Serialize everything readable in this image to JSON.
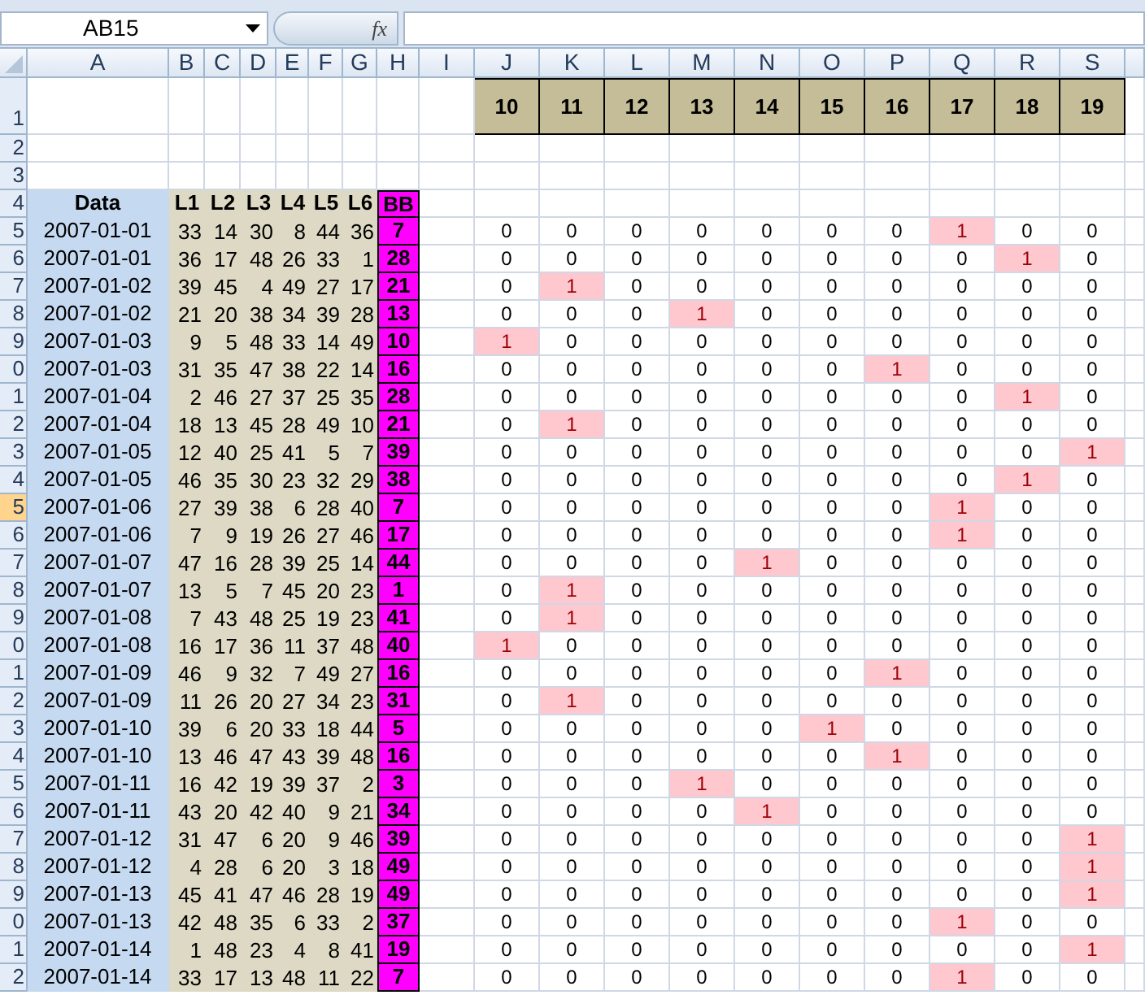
{
  "name_box": {
    "value": "AB15"
  },
  "function_button": "fx",
  "column_headers": [
    "A",
    "B",
    "C",
    "D",
    "E",
    "F",
    "G",
    "H",
    "I",
    "J",
    "K",
    "L",
    "M",
    "N",
    "O",
    "P",
    "Q",
    "R",
    "S"
  ],
  "row_headers": [
    {
      "text": "1",
      "selected": false
    },
    {
      "text": "2",
      "selected": false
    },
    {
      "text": "3",
      "selected": false
    },
    {
      "text": "4",
      "selected": false
    },
    {
      "text": "5",
      "selected": false
    },
    {
      "text": "6",
      "selected": false
    },
    {
      "text": "7",
      "selected": false
    },
    {
      "text": "8",
      "selected": false
    },
    {
      "text": "9",
      "selected": false
    },
    {
      "text": "0",
      "selected": false
    },
    {
      "text": "1",
      "selected": false
    },
    {
      "text": "2",
      "selected": false
    },
    {
      "text": "3",
      "selected": false
    },
    {
      "text": "4",
      "selected": false
    },
    {
      "text": "5",
      "selected": true
    },
    {
      "text": "6",
      "selected": false
    },
    {
      "text": "7",
      "selected": false
    },
    {
      "text": "8",
      "selected": false
    },
    {
      "text": "9",
      "selected": false
    },
    {
      "text": "0",
      "selected": false
    },
    {
      "text": "1",
      "selected": false
    },
    {
      "text": "2",
      "selected": false
    },
    {
      "text": "3",
      "selected": false
    },
    {
      "text": "4",
      "selected": false
    },
    {
      "text": "5",
      "selected": false
    },
    {
      "text": "6",
      "selected": false
    },
    {
      "text": "7",
      "selected": false
    },
    {
      "text": "8",
      "selected": false
    },
    {
      "text": "9",
      "selected": false
    },
    {
      "text": "0",
      "selected": false
    },
    {
      "text": "1",
      "selected": false
    },
    {
      "text": "2",
      "selected": false
    }
  ],
  "bin_headers": [
    "10",
    "11",
    "12",
    "13",
    "14",
    "15",
    "16",
    "17",
    "18",
    "19"
  ],
  "table_header": {
    "date": "Data",
    "numbers": [
      "L1",
      "L2",
      "L3",
      "L4",
      "L5",
      "L6"
    ],
    "bb": "BB"
  },
  "rows": [
    {
      "date": "2007-01-01",
      "numbers": [
        "33",
        "14",
        "30",
        "8",
        "44",
        "36"
      ],
      "bb": "7",
      "flags": [
        "0",
        "0",
        "0",
        "0",
        "0",
        "0",
        "0",
        "1",
        "0",
        "0"
      ],
      "highlighted": [
        false,
        false,
        false,
        false,
        false,
        false,
        false,
        true,
        false,
        false
      ]
    },
    {
      "date": "2007-01-01",
      "numbers": [
        "36",
        "17",
        "48",
        "26",
        "33",
        "1"
      ],
      "bb": "28",
      "flags": [
        "0",
        "0",
        "0",
        "0",
        "0",
        "0",
        "0",
        "0",
        "1",
        "0"
      ],
      "highlighted": [
        false,
        false,
        false,
        false,
        false,
        false,
        false,
        false,
        true,
        false
      ]
    },
    {
      "date": "2007-01-02",
      "numbers": [
        "39",
        "45",
        "4",
        "49",
        "27",
        "17"
      ],
      "bb": "21",
      "flags": [
        "0",
        "1",
        "0",
        "0",
        "0",
        "0",
        "0",
        "0",
        "0",
        "0"
      ],
      "highlighted": [
        false,
        true,
        false,
        false,
        false,
        false,
        false,
        false,
        false,
        false
      ]
    },
    {
      "date": "2007-01-02",
      "numbers": [
        "21",
        "20",
        "38",
        "34",
        "39",
        "28"
      ],
      "bb": "13",
      "flags": [
        "0",
        "0",
        "0",
        "1",
        "0",
        "0",
        "0",
        "0",
        "0",
        "0"
      ],
      "highlighted": [
        false,
        false,
        false,
        true,
        false,
        false,
        false,
        false,
        false,
        false
      ]
    },
    {
      "date": "2007-01-03",
      "numbers": [
        "9",
        "5",
        "48",
        "33",
        "14",
        "49"
      ],
      "bb": "10",
      "flags": [
        "1",
        "0",
        "0",
        "0",
        "0",
        "0",
        "0",
        "0",
        "0",
        "0"
      ],
      "highlighted": [
        true,
        false,
        false,
        false,
        false,
        false,
        false,
        false,
        false,
        false
      ]
    },
    {
      "date": "2007-01-03",
      "numbers": [
        "31",
        "35",
        "47",
        "38",
        "22",
        "14"
      ],
      "bb": "16",
      "flags": [
        "0",
        "0",
        "0",
        "0",
        "0",
        "0",
        "1",
        "0",
        "0",
        "0"
      ],
      "highlighted": [
        false,
        false,
        false,
        false,
        false,
        false,
        true,
        false,
        false,
        false
      ]
    },
    {
      "date": "2007-01-04",
      "numbers": [
        "2",
        "46",
        "27",
        "37",
        "25",
        "35"
      ],
      "bb": "28",
      "flags": [
        "0",
        "0",
        "0",
        "0",
        "0",
        "0",
        "0",
        "0",
        "1",
        "0"
      ],
      "highlighted": [
        false,
        false,
        false,
        false,
        false,
        false,
        false,
        false,
        true,
        false
      ]
    },
    {
      "date": "2007-01-04",
      "numbers": [
        "18",
        "13",
        "45",
        "28",
        "49",
        "10"
      ],
      "bb": "21",
      "flags": [
        "0",
        "1",
        "0",
        "0",
        "0",
        "0",
        "0",
        "0",
        "0",
        "0"
      ],
      "highlighted": [
        false,
        true,
        false,
        false,
        false,
        false,
        false,
        false,
        false,
        false
      ]
    },
    {
      "date": "2007-01-05",
      "numbers": [
        "12",
        "40",
        "25",
        "41",
        "5",
        "7"
      ],
      "bb": "39",
      "flags": [
        "0",
        "0",
        "0",
        "0",
        "0",
        "0",
        "0",
        "0",
        "0",
        "1"
      ],
      "highlighted": [
        false,
        false,
        false,
        false,
        false,
        false,
        false,
        false,
        false,
        true
      ]
    },
    {
      "date": "2007-01-05",
      "numbers": [
        "46",
        "35",
        "30",
        "23",
        "32",
        "29"
      ],
      "bb": "38",
      "flags": [
        "0",
        "0",
        "0",
        "0",
        "0",
        "0",
        "0",
        "0",
        "1",
        "0"
      ],
      "highlighted": [
        false,
        false,
        false,
        false,
        false,
        false,
        false,
        false,
        true,
        false
      ]
    },
    {
      "date": "2007-01-06",
      "numbers": [
        "27",
        "39",
        "38",
        "6",
        "28",
        "40"
      ],
      "bb": "7",
      "flags": [
        "0",
        "0",
        "0",
        "0",
        "0",
        "0",
        "0",
        "1",
        "0",
        "0"
      ],
      "highlighted": [
        false,
        false,
        false,
        false,
        false,
        false,
        false,
        true,
        false,
        false
      ]
    },
    {
      "date": "2007-01-06",
      "numbers": [
        "7",
        "9",
        "19",
        "26",
        "27",
        "46"
      ],
      "bb": "17",
      "flags": [
        "0",
        "0",
        "0",
        "0",
        "0",
        "0",
        "0",
        "1",
        "0",
        "0"
      ],
      "highlighted": [
        false,
        false,
        false,
        false,
        false,
        false,
        false,
        true,
        false,
        false
      ]
    },
    {
      "date": "2007-01-07",
      "numbers": [
        "47",
        "16",
        "28",
        "39",
        "25",
        "14"
      ],
      "bb": "44",
      "flags": [
        "0",
        "0",
        "0",
        "0",
        "1",
        "0",
        "0",
        "0",
        "0",
        "0"
      ],
      "highlighted": [
        false,
        false,
        false,
        false,
        true,
        false,
        false,
        false,
        false,
        false
      ]
    },
    {
      "date": "2007-01-07",
      "numbers": [
        "13",
        "5",
        "7",
        "45",
        "20",
        "23"
      ],
      "bb": "1",
      "flags": [
        "0",
        "1",
        "0",
        "0",
        "0",
        "0",
        "0",
        "0",
        "0",
        "0"
      ],
      "highlighted": [
        false,
        true,
        false,
        false,
        false,
        false,
        false,
        false,
        false,
        false
      ]
    },
    {
      "date": "2007-01-08",
      "numbers": [
        "7",
        "43",
        "48",
        "25",
        "19",
        "23"
      ],
      "bb": "41",
      "flags": [
        "0",
        "1",
        "0",
        "0",
        "0",
        "0",
        "0",
        "0",
        "0",
        "0"
      ],
      "highlighted": [
        false,
        true,
        false,
        false,
        false,
        false,
        false,
        false,
        false,
        false
      ]
    },
    {
      "date": "2007-01-08",
      "numbers": [
        "16",
        "17",
        "36",
        "11",
        "37",
        "48"
      ],
      "bb": "40",
      "flags": [
        "1",
        "0",
        "0",
        "0",
        "0",
        "0",
        "0",
        "0",
        "0",
        "0"
      ],
      "highlighted": [
        true,
        false,
        false,
        false,
        false,
        false,
        false,
        false,
        false,
        false
      ]
    },
    {
      "date": "2007-01-09",
      "numbers": [
        "46",
        "9",
        "32",
        "7",
        "49",
        "27"
      ],
      "bb": "16",
      "flags": [
        "0",
        "0",
        "0",
        "0",
        "0",
        "0",
        "1",
        "0",
        "0",
        "0"
      ],
      "highlighted": [
        false,
        false,
        false,
        false,
        false,
        false,
        true,
        false,
        false,
        false
      ]
    },
    {
      "date": "2007-01-09",
      "numbers": [
        "11",
        "26",
        "20",
        "27",
        "34",
        "23"
      ],
      "bb": "31",
      "flags": [
        "0",
        "1",
        "0",
        "0",
        "0",
        "0",
        "0",
        "0",
        "0",
        "0"
      ],
      "highlighted": [
        false,
        true,
        false,
        false,
        false,
        false,
        false,
        false,
        false,
        false
      ]
    },
    {
      "date": "2007-01-10",
      "numbers": [
        "39",
        "6",
        "20",
        "33",
        "18",
        "44"
      ],
      "bb": "5",
      "flags": [
        "0",
        "0",
        "0",
        "0",
        "0",
        "1",
        "0",
        "0",
        "0",
        "0"
      ],
      "highlighted": [
        false,
        false,
        false,
        false,
        false,
        true,
        false,
        false,
        false,
        false
      ]
    },
    {
      "date": "2007-01-10",
      "numbers": [
        "13",
        "46",
        "47",
        "43",
        "39",
        "48"
      ],
      "bb": "16",
      "flags": [
        "0",
        "0",
        "0",
        "0",
        "0",
        "0",
        "1",
        "0",
        "0",
        "0"
      ],
      "highlighted": [
        false,
        false,
        false,
        false,
        false,
        false,
        true,
        false,
        false,
        false
      ]
    },
    {
      "date": "2007-01-11",
      "numbers": [
        "16",
        "42",
        "19",
        "39",
        "37",
        "2"
      ],
      "bb": "3",
      "flags": [
        "0",
        "0",
        "0",
        "1",
        "0",
        "0",
        "0",
        "0",
        "0",
        "0"
      ],
      "highlighted": [
        false,
        false,
        false,
        true,
        false,
        false,
        false,
        false,
        false,
        false
      ]
    },
    {
      "date": "2007-01-11",
      "numbers": [
        "43",
        "20",
        "42",
        "40",
        "9",
        "21"
      ],
      "bb": "34",
      "flags": [
        "0",
        "0",
        "0",
        "0",
        "1",
        "0",
        "0",
        "0",
        "0",
        "0"
      ],
      "highlighted": [
        false,
        false,
        false,
        false,
        true,
        false,
        false,
        false,
        false,
        false
      ]
    },
    {
      "date": "2007-01-12",
      "numbers": [
        "31",
        "47",
        "6",
        "20",
        "9",
        "46"
      ],
      "bb": "39",
      "flags": [
        "0",
        "0",
        "0",
        "0",
        "0",
        "0",
        "0",
        "0",
        "0",
        "1"
      ],
      "highlighted": [
        false,
        false,
        false,
        false,
        false,
        false,
        false,
        false,
        false,
        true
      ]
    },
    {
      "date": "2007-01-12",
      "numbers": [
        "4",
        "28",
        "6",
        "20",
        "3",
        "18"
      ],
      "bb": "49",
      "flags": [
        "0",
        "0",
        "0",
        "0",
        "0",
        "0",
        "0",
        "0",
        "0",
        "1"
      ],
      "highlighted": [
        false,
        false,
        false,
        false,
        false,
        false,
        false,
        false,
        false,
        true
      ]
    },
    {
      "date": "2007-01-13",
      "numbers": [
        "45",
        "41",
        "47",
        "46",
        "28",
        "19"
      ],
      "bb": "49",
      "flags": [
        "0",
        "0",
        "0",
        "0",
        "0",
        "0",
        "0",
        "0",
        "0",
        "1"
      ],
      "highlighted": [
        false,
        false,
        false,
        false,
        false,
        false,
        false,
        false,
        false,
        true
      ]
    },
    {
      "date": "2007-01-13",
      "numbers": [
        "42",
        "48",
        "35",
        "6",
        "33",
        "2"
      ],
      "bb": "37",
      "flags": [
        "0",
        "0",
        "0",
        "0",
        "0",
        "0",
        "0",
        "1",
        "0",
        "0"
      ],
      "highlighted": [
        false,
        false,
        false,
        false,
        false,
        false,
        false,
        true,
        false,
        false
      ]
    },
    {
      "date": "2007-01-14",
      "numbers": [
        "1",
        "48",
        "23",
        "4",
        "8",
        "41"
      ],
      "bb": "19",
      "flags": [
        "0",
        "0",
        "0",
        "0",
        "0",
        "0",
        "0",
        "0",
        "0",
        "1"
      ],
      "highlighted": [
        false,
        false,
        false,
        false,
        false,
        false,
        false,
        false,
        false,
        true
      ]
    },
    {
      "date": "2007-01-14",
      "numbers": [
        "33",
        "17",
        "13",
        "48",
        "11",
        "22"
      ],
      "bb": "7",
      "flags": [
        "0",
        "0",
        "0",
        "0",
        "0",
        "0",
        "0",
        "1",
        "0",
        "0"
      ],
      "highlighted": [
        false,
        false,
        false,
        false,
        false,
        false,
        false,
        true,
        false,
        false
      ]
    }
  ]
}
